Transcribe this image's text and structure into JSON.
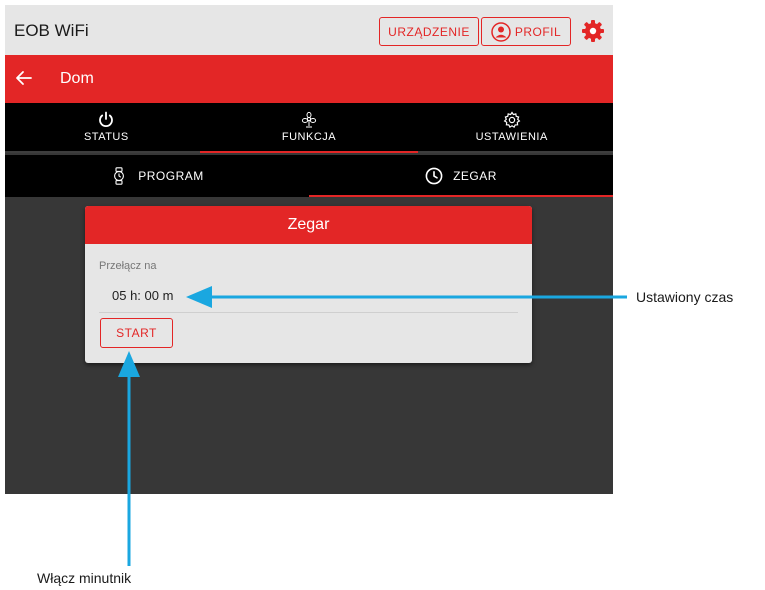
{
  "app": {
    "title": "EOB WiFi"
  },
  "header": {
    "device_label": "URZĄDZENIE",
    "profile_label": "PROFIL",
    "settings_icon": "gear-icon",
    "profile_icon": "person-icon"
  },
  "nav": {
    "back_icon": "arrow-left-icon",
    "page_name": "Dom"
  },
  "main_tabs": [
    {
      "label": "STATUS",
      "icon": "power-icon",
      "active": false
    },
    {
      "label": "FUNKCJA",
      "icon": "fan-icon",
      "active": true
    },
    {
      "label": "USTAWIENIA",
      "icon": "gear-outline-icon",
      "active": false
    }
  ],
  "sub_tabs": [
    {
      "label": "PROGRAM",
      "icon": "watch-icon",
      "active": false
    },
    {
      "label": "ZEGAR",
      "icon": "clock-icon",
      "active": true
    }
  ],
  "card": {
    "title": "Zegar",
    "label": "Przełącz na",
    "time_value": "05 h: 00 m",
    "start_label": "START"
  },
  "annotations": {
    "time_callout": "Ustawiony czas",
    "start_callout": "Włącz minutnik"
  },
  "colors": {
    "accent": "#e32626",
    "callout_arrow": "#1aa7e0",
    "dark_background": "#373737",
    "topbar": "#e6e6e6"
  }
}
